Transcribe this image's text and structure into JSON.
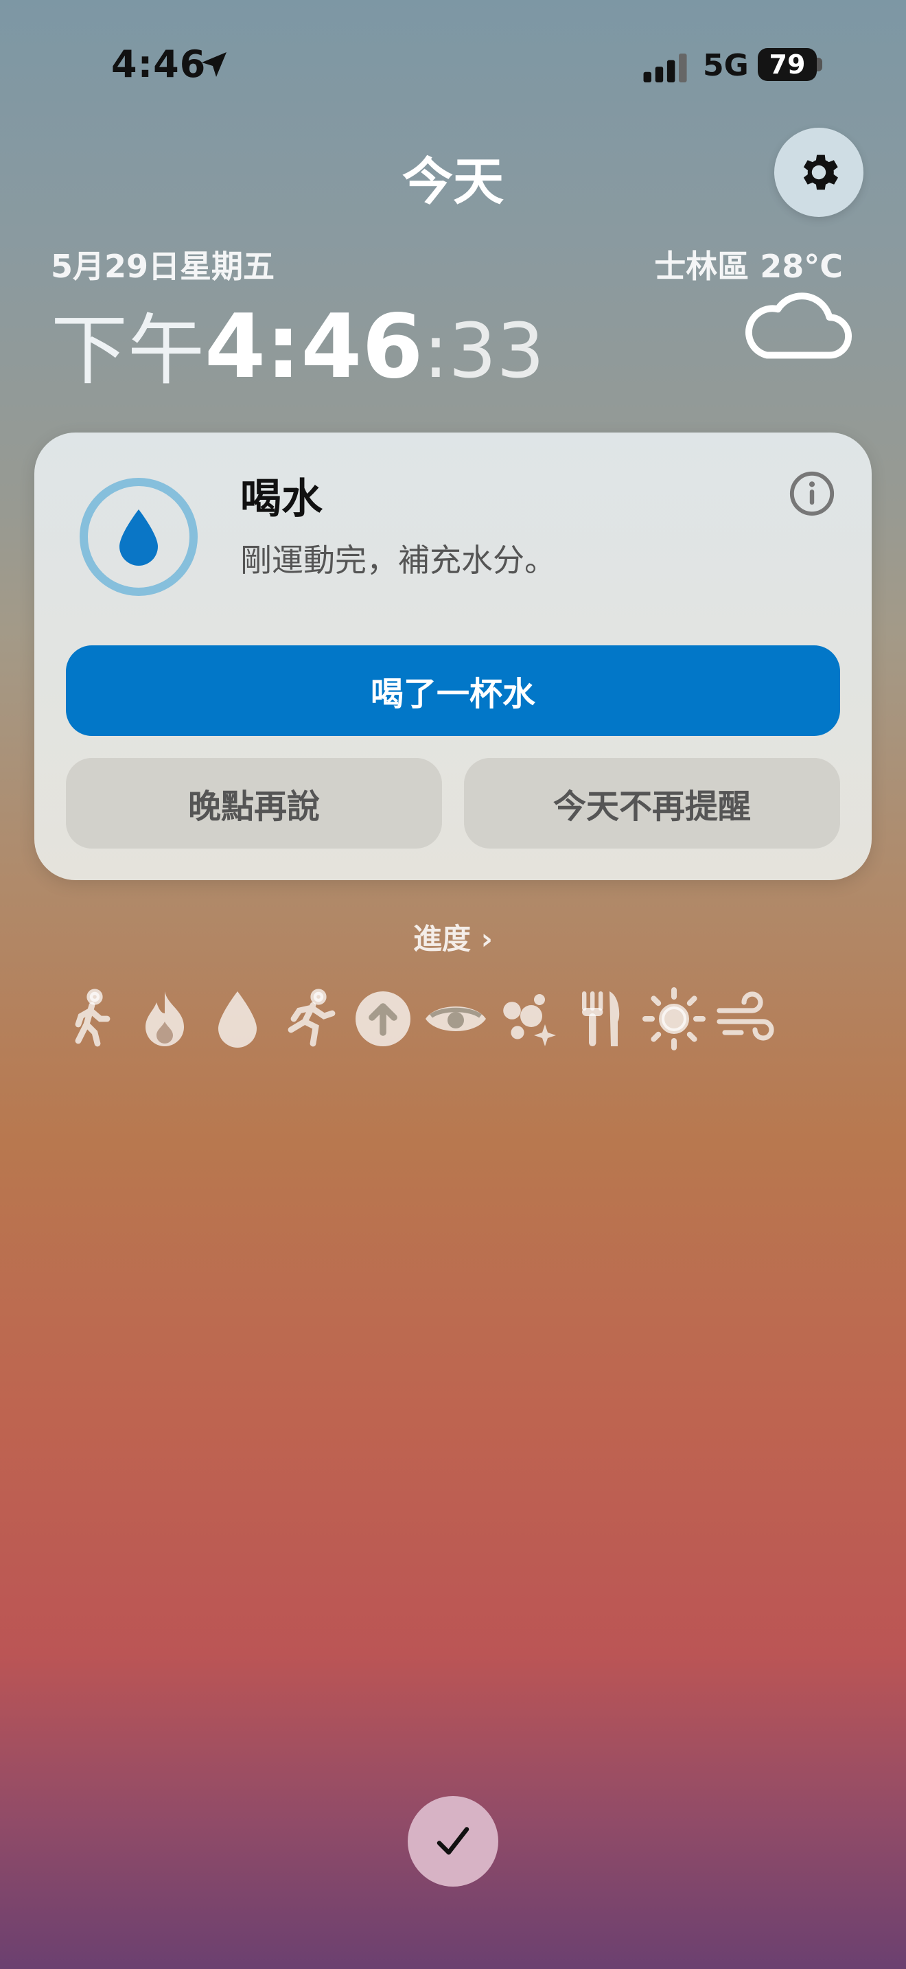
{
  "status_bar": {
    "time": "4:46",
    "network": "5G",
    "battery": "79",
    "location_icon": "location-arrow-icon",
    "signal_icon": "cellular-signal-icon"
  },
  "header": {
    "title": "今天",
    "settings_icon": "gear-icon"
  },
  "today": {
    "date": "5月29日星期五",
    "location_weather": "士林區 28°C",
    "weather_icon": "cloud-icon",
    "clock_ampm": "下午",
    "clock_hm": "4:46",
    "clock_seconds": ":33"
  },
  "reminder": {
    "icon": "water-drop-icon",
    "title": "喝水",
    "message": "剛運動完，補充水分。",
    "info_icon": "info-icon",
    "primary_action": "喝了一杯水",
    "later_action": "晚點再說",
    "dismiss_action": "今天不再提醒"
  },
  "progress": {
    "label": "進度",
    "icons": [
      "walking-icon",
      "flame-icon",
      "water-drop-icon",
      "running-icon",
      "up-arrow-circle-icon",
      "eye-icon",
      "sparkles-icon",
      "fork-knife-icon",
      "sun-icon",
      "wind-icon"
    ]
  },
  "bottom": {
    "check_icon": "checkmark-icon"
  },
  "colors": {
    "primary_button": "#0277c8",
    "drop_ring": "#86bfdc",
    "drop": "#0a76c6"
  }
}
